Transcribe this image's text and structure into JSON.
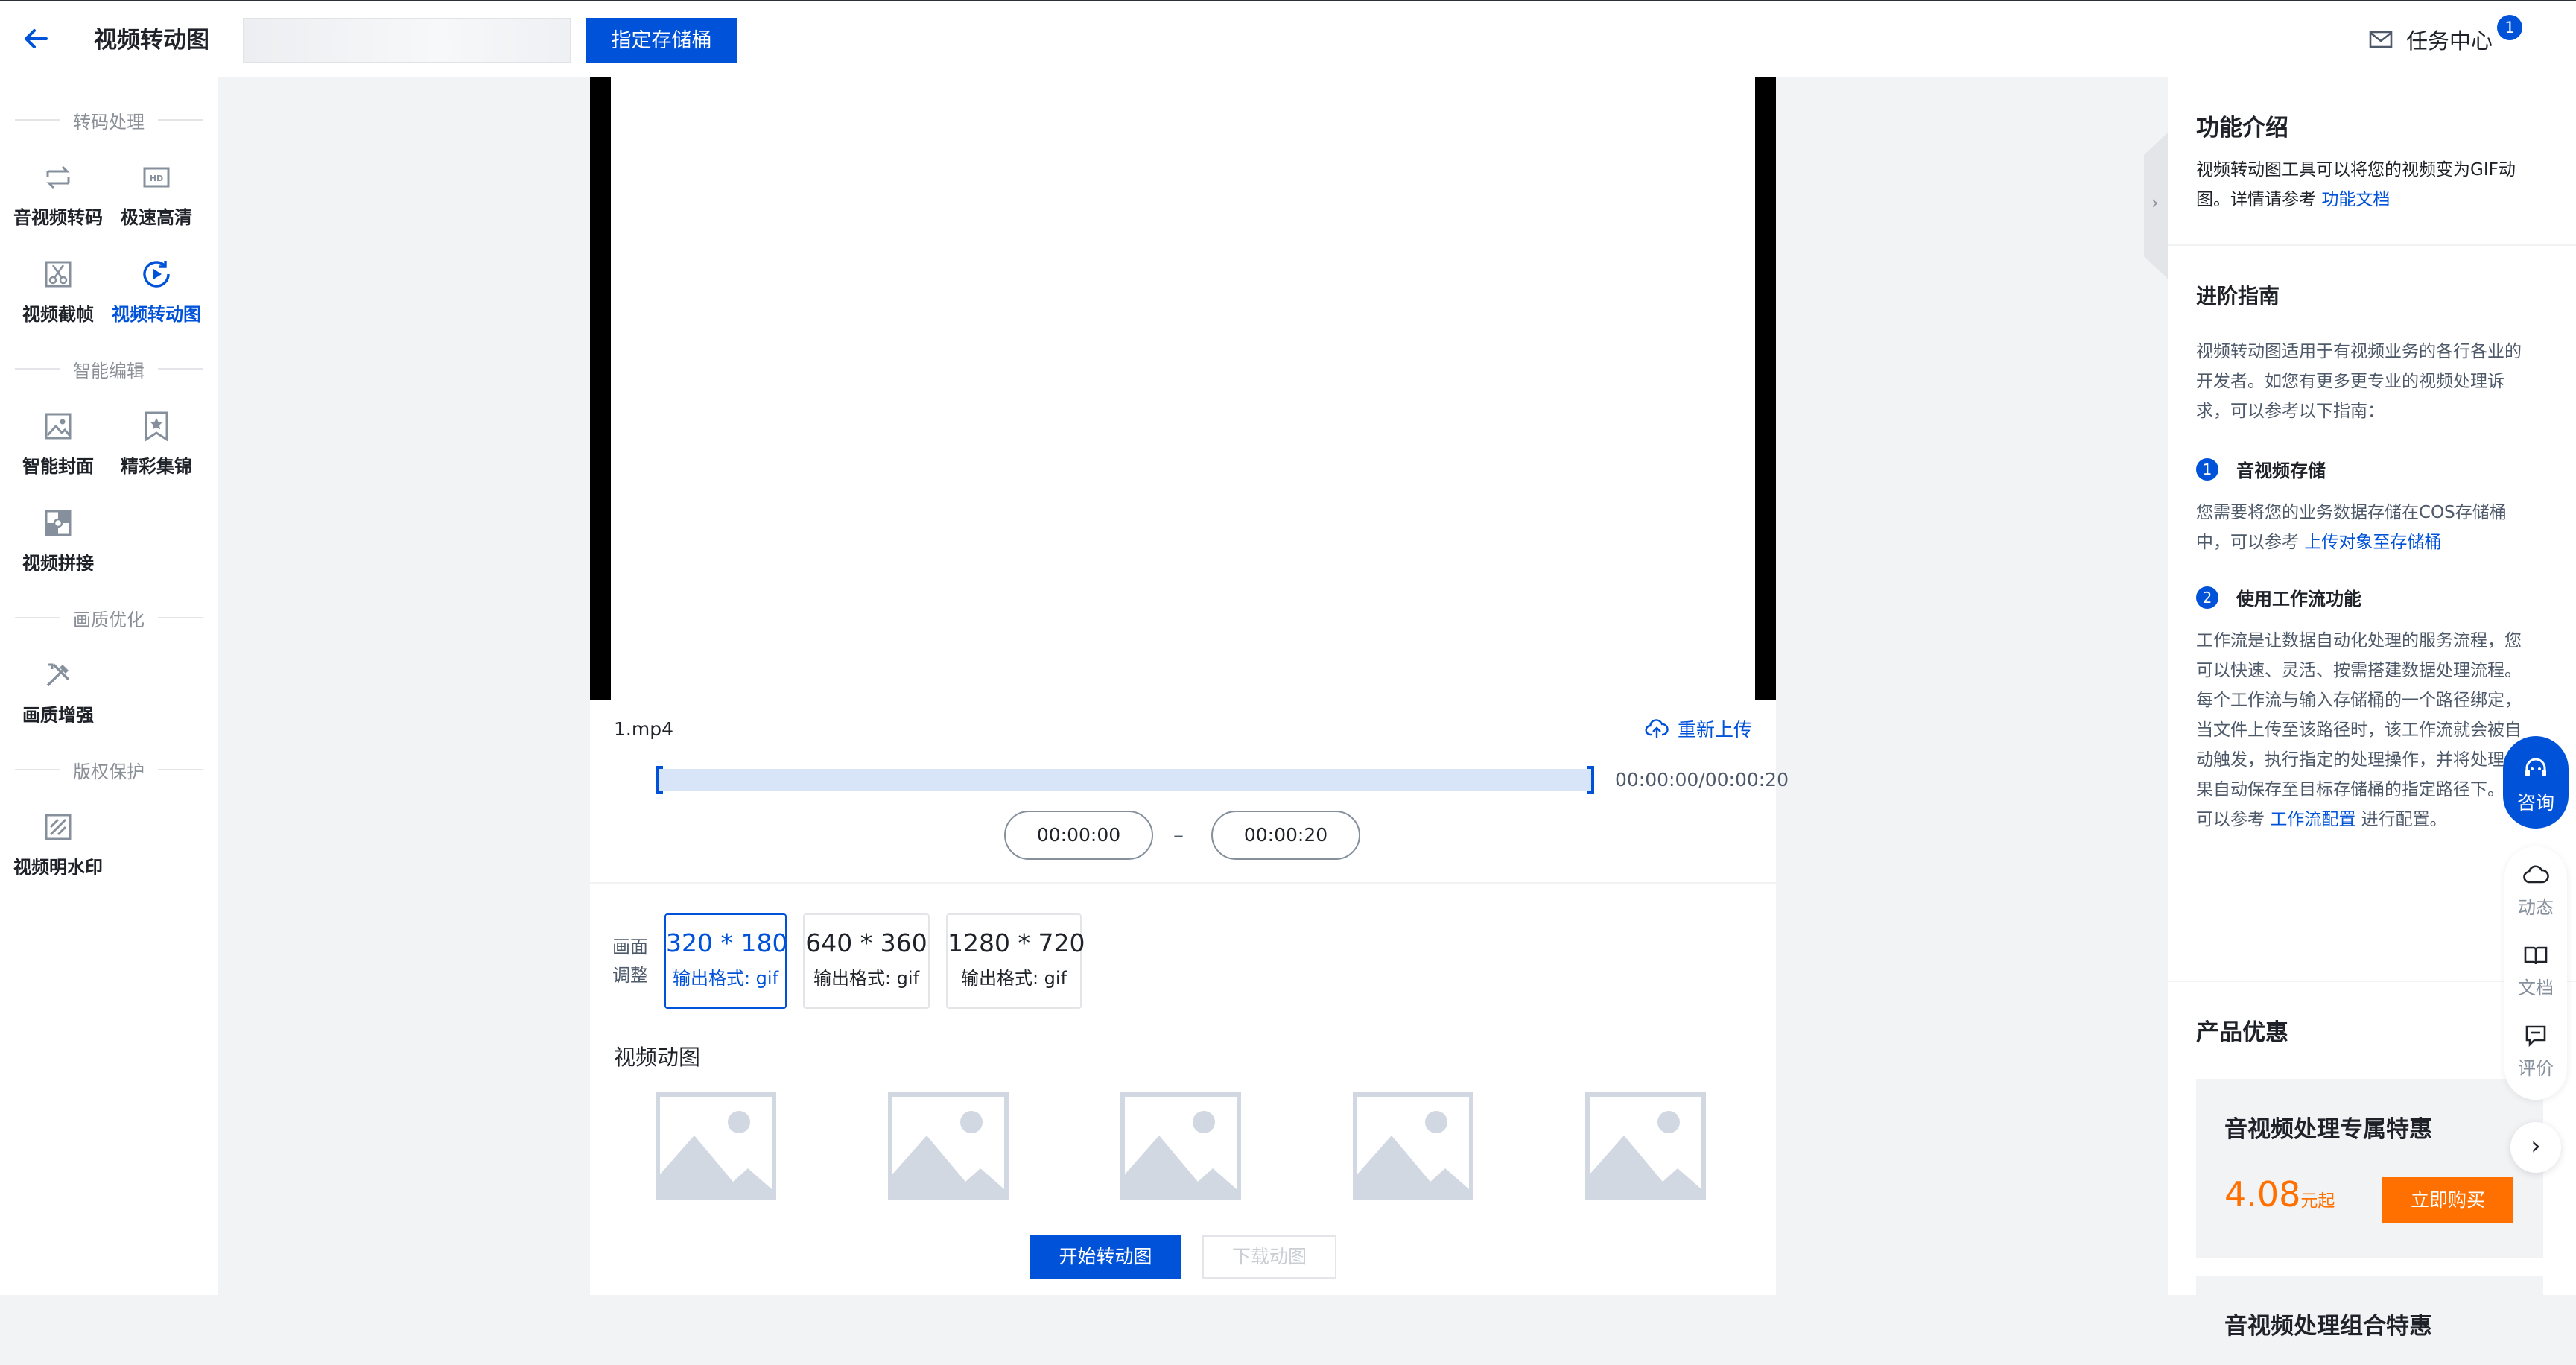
{
  "header": {
    "title": "视频转动图",
    "bucket_placeholder": "",
    "bucket_button": "指定存储桶",
    "task_center": "任务中心",
    "task_badge": "1"
  },
  "sidebar": {
    "sections": [
      "转码处理",
      "智能编辑",
      "画质优化",
      "版权保护"
    ],
    "items": [
      {
        "label": "音视频转码",
        "icon": "transcode-icon"
      },
      {
        "label": "极速高清",
        "icon": "hd-icon"
      },
      {
        "label": "视频截帧",
        "icon": "scissors-icon"
      },
      {
        "label": "视频转动图",
        "icon": "video-gif-icon",
        "active": true
      },
      {
        "label": "智能封面",
        "icon": "image-icon"
      },
      {
        "label": "精彩集锦",
        "icon": "star-bookmark-icon"
      },
      {
        "label": "视频拼接",
        "icon": "splice-icon"
      },
      {
        "label": "画质增强",
        "icon": "tools-icon"
      },
      {
        "label": "视频明水印",
        "icon": "watermark-icon"
      }
    ]
  },
  "editor": {
    "file_name": "1.mp4",
    "reupload": "重新上传",
    "duration": "00:00:00/00:00:20",
    "start_time": "00:00:00",
    "end_time": "00:00:20",
    "separator": "–",
    "adjust_label": "画面调整",
    "resolutions": [
      {
        "size": "320 * 180",
        "format": "输出格式: gif",
        "selected": true
      },
      {
        "size": "640 * 360",
        "format": "输出格式: gif",
        "selected": false
      },
      {
        "size": "1280 * 720",
        "format": "输出格式: gif",
        "selected": false
      }
    ],
    "animation_title": "视频动图",
    "start_button": "开始转动图",
    "download_button": "下载动图"
  },
  "right_panel": {
    "intro_title": "功能介绍",
    "intro_text": "视频转动图工具可以将您的视频变为GIF动图。详情请参考",
    "intro_link": "功能文档",
    "guide_title": "进阶指南",
    "guide_text": "视频转动图适用于有视频业务的各行各业的开发者。如您有更多更专业的视频处理诉求，可以参考以下指南：",
    "step1_num": "1",
    "step1_title": "音视频存储",
    "step1_text": "您需要将您的业务数据存储在COS存储桶中，可以参考",
    "step1_link": "上传对象至存储桶",
    "step2_num": "2",
    "step2_title": "使用工作流功能",
    "step2_text": "工作流是让数据自动化处理的服务流程，您可以快速、灵活、按需搭建数据处理流程。每个工作流与输入存储桶的一个路径绑定，当文件上传至该路径时，该工作流就会被自动触发，执行指定的处理操作，并将处理结果自动保存至目标存储桶的指定路径下。您可以参考",
    "step2_link": "工作流配置",
    "step2_suffix": "进行配置。",
    "promo_title": "产品优惠",
    "promo1_title": "音视频处理专属特惠",
    "promo1_price": "4.08",
    "promo1_unit": "元起",
    "promo1_button": "立即购买",
    "promo2_title": "音视频处理组合特惠"
  },
  "float": {
    "consult": "咨询",
    "news": "动态",
    "docs": "文档",
    "review": "评价"
  },
  "colors": {
    "primary": "#0052d9",
    "orange": "#ff7000",
    "page_bg": "#f2f3f5"
  }
}
